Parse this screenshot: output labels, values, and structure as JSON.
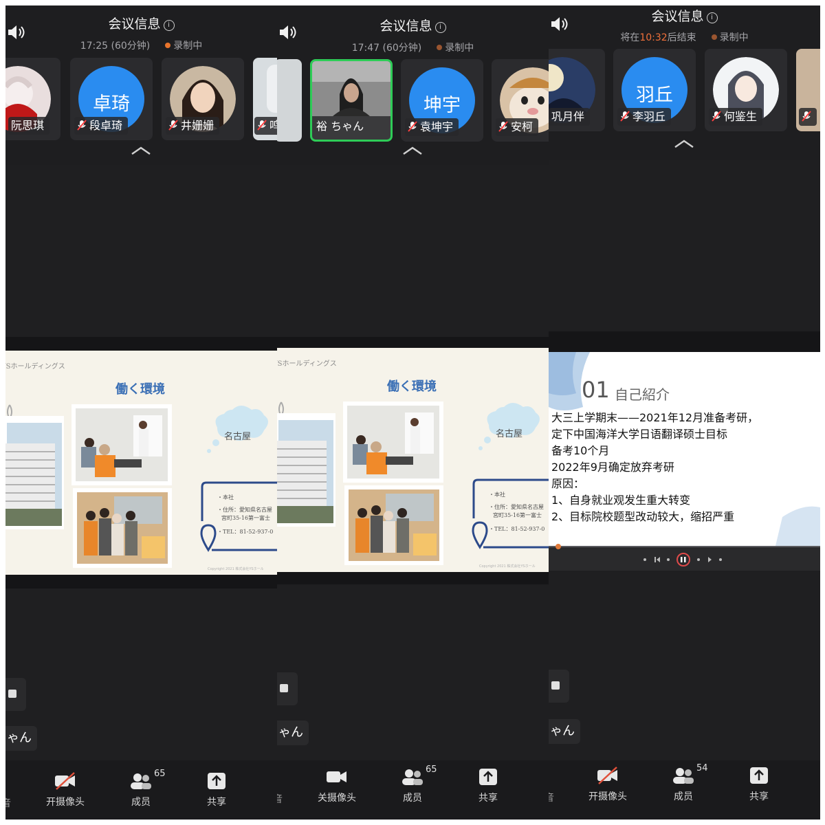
{
  "panels": [
    {
      "title": "会议信息",
      "duration": "17:25 (60分钟)",
      "recording": "录制中",
      "participants": [
        "阮思琪",
        "段卓琦",
        "井姗姗",
        "鸣"
      ],
      "avatar_text": "卓琦",
      "chip_text": "ゃん",
      "toolbar": {
        "camera": "开摄像头",
        "members": "成员",
        "members_count": "65",
        "share": "共享",
        "edge": "音"
      }
    },
    {
      "title": "会议信息",
      "duration": "17:47 (60分钟)",
      "recording": "录制中",
      "participants": [
        "裕 ちゃん",
        "袁坤宇",
        "安柯"
      ],
      "avatar_text": "坤宇",
      "chip_text": "ゃん",
      "toolbar": {
        "camera": "关摄像头",
        "members": "成员",
        "members_count": "65",
        "share": "共享",
        "edge": "音"
      }
    },
    {
      "title": "会议信息",
      "ends_prefix": "将在",
      "ends_time": "10:32",
      "ends_suffix": "后结束",
      "recording": "录制中",
      "participants": [
        "巩月伴",
        "李羽丘",
        "何鉴生"
      ],
      "avatar_text": "羽丘",
      "chip_text": "ゃん",
      "toolbar": {
        "camera": "开摄像头",
        "members": "成员",
        "members_count": "54",
        "share": "共享",
        "edge": "音"
      }
    }
  ],
  "slide_a": {
    "company": "YSホールディングス",
    "heading": "働く環境",
    "cloud": "名古屋",
    "addr1": "・本社",
    "addr2": "・住所：愛知県名古屋",
    "addr3": "宮町35-16第一富士",
    "addr4": "・TEL：81-52-937-0",
    "copyright": "Copyright 2021 株式会社YSホール"
  },
  "slide_b": {
    "number": "01",
    "heading": "自己紹介",
    "lines": [
      "大三上学期末——2021年12月准备考研，",
      "定下中国海洋大学日语翻译硕士目标",
      "备考10个月",
      "2022年9月确定放弃考研",
      "原因：",
      "1、自身就业观发生重大转变",
      "2、目标院校题型改动较大，缩招严重"
    ]
  }
}
